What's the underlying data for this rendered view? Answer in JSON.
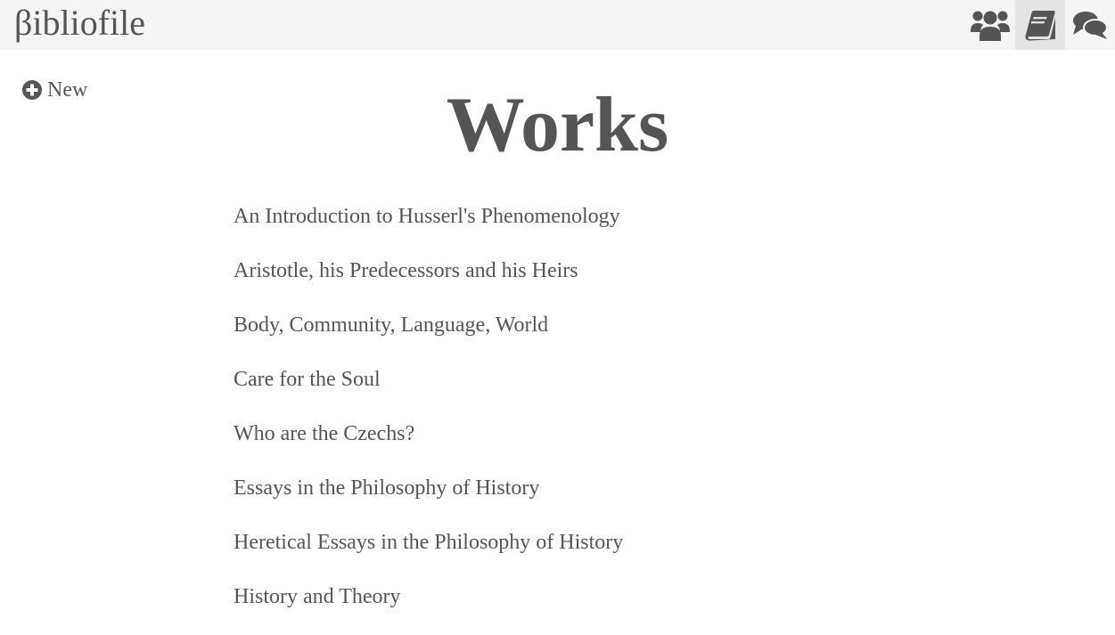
{
  "navbar": {
    "brand": "βibliofile",
    "icons": [
      {
        "name": "users-icon",
        "active": false
      },
      {
        "name": "book-icon",
        "active": true
      },
      {
        "name": "comments-icon",
        "active": false
      }
    ]
  },
  "sidebar": {
    "new_label": "New",
    "new_icon": "plus-circle-icon"
  },
  "main": {
    "title": "Works",
    "works": [
      "An Introduction to Husserl's Phenomenology",
      "Aristotle, his Predecessors and his Heirs",
      "Body, Community, Language, World",
      "Care for the Soul",
      "Who are the Czechs?",
      "Essays in the Philosophy of History",
      "Heretical Essays in the Philosophy of History",
      "History and Theory"
    ]
  },
  "colors": {
    "text": "#555555",
    "navbar_bg": "#f4f4f4",
    "active_nav_bg": "#e4e4e4"
  }
}
